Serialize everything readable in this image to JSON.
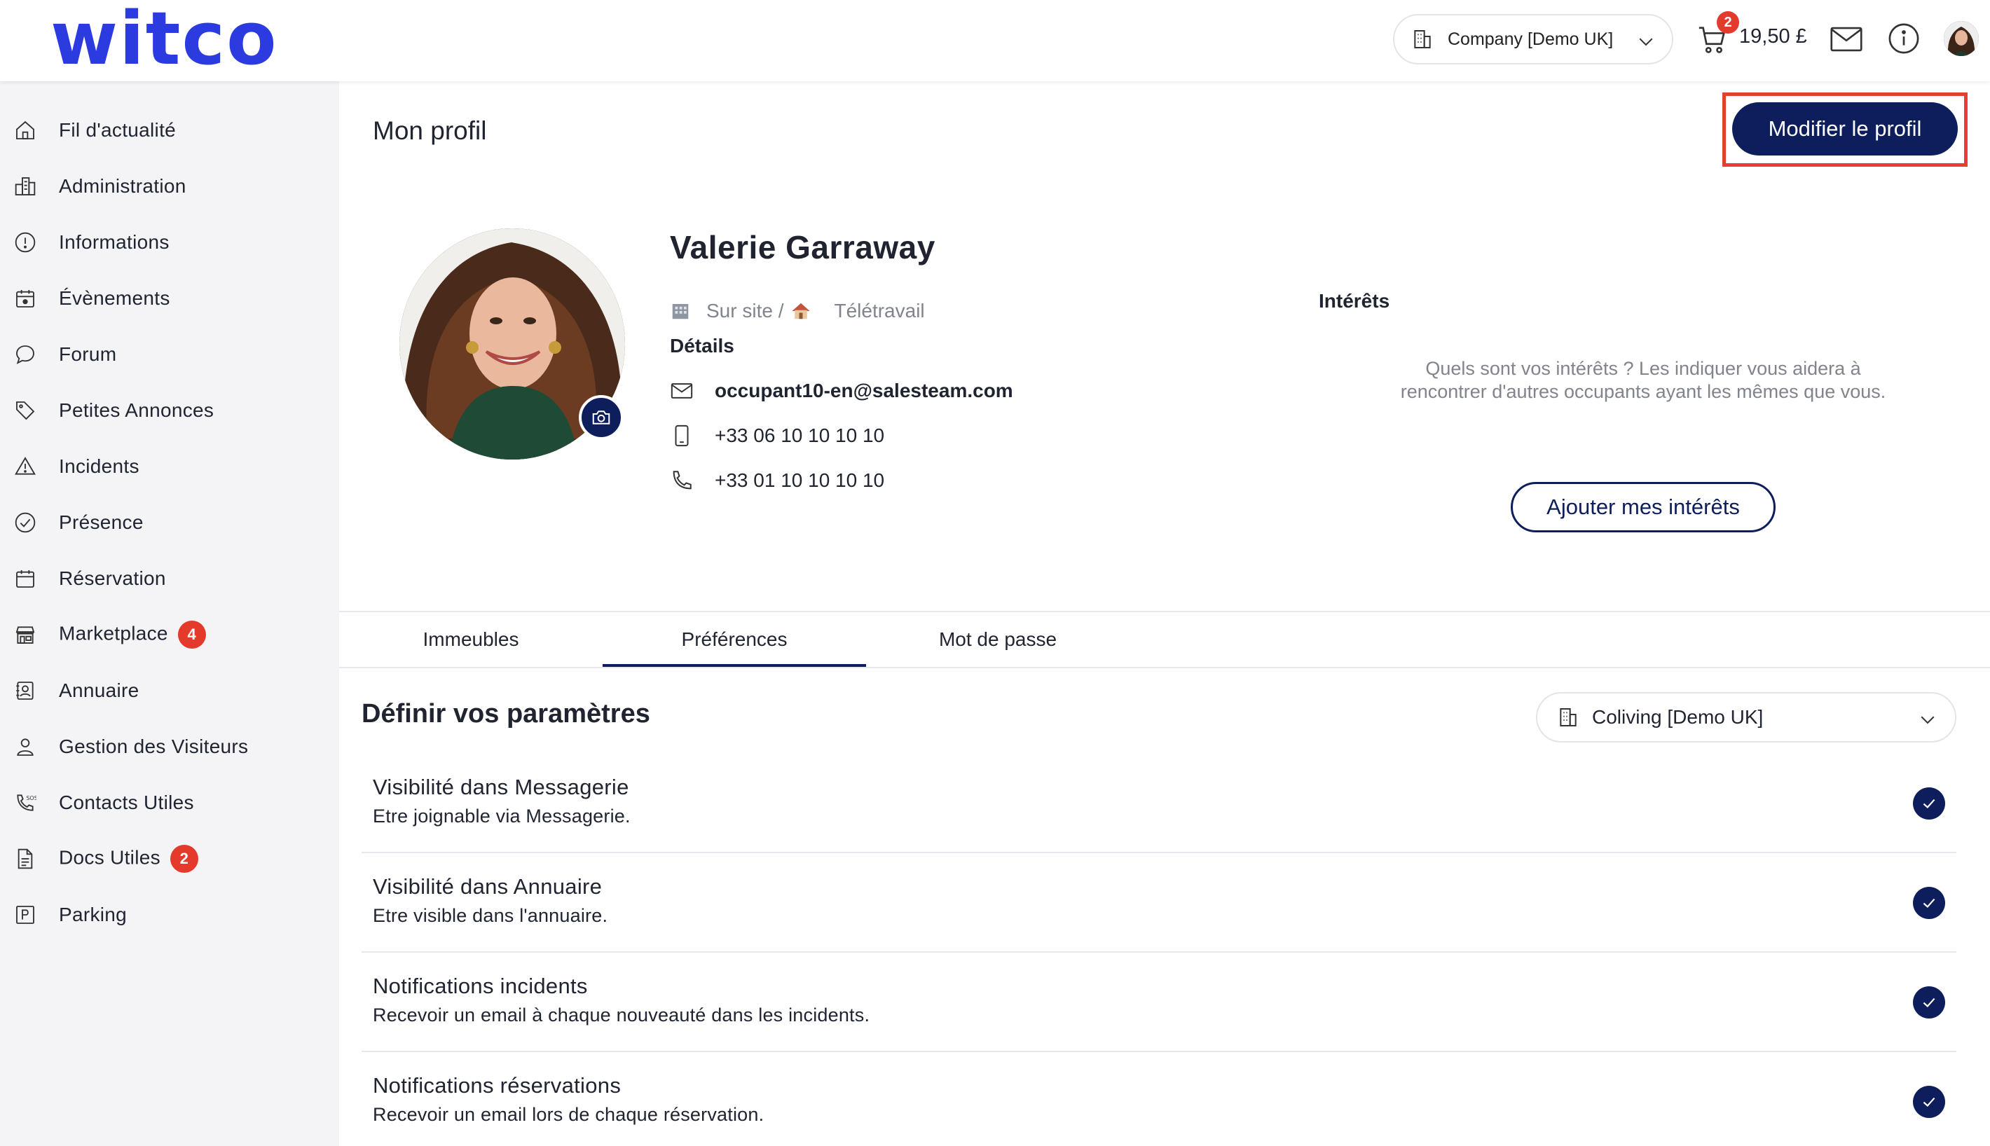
{
  "header": {
    "logo": "witco",
    "company_select": "Company [Demo UK]",
    "cart_count": "2",
    "cart_total": "19,50 £",
    "icons": [
      "building-icon",
      "chevron-down-icon",
      "cart-icon",
      "mail-icon",
      "info-icon",
      "avatar"
    ]
  },
  "sidebar": {
    "items": [
      {
        "label": "Fil d'actualité",
        "icon": "home-icon"
      },
      {
        "label": "Administration",
        "icon": "buildings-icon"
      },
      {
        "label": "Informations",
        "icon": "info-icon"
      },
      {
        "label": "Évènements",
        "icon": "calendar-star-icon"
      },
      {
        "label": "Forum",
        "icon": "chat-bubble-icon"
      },
      {
        "label": "Petites Annonces",
        "icon": "tag-icon"
      },
      {
        "label": "Incidents",
        "icon": "warning-icon"
      },
      {
        "label": "Présence",
        "icon": "check-circle-icon"
      },
      {
        "label": "Réservation",
        "icon": "calendar-icon"
      },
      {
        "label": "Marketplace",
        "icon": "store-icon",
        "badge": "4"
      },
      {
        "label": "Annuaire",
        "icon": "contact-book-icon"
      },
      {
        "label": "Gestion des Visiteurs",
        "icon": "visitor-icon"
      },
      {
        "label": "Contacts Utiles",
        "icon": "sos-phone-icon"
      },
      {
        "label": "Docs Utiles",
        "icon": "document-icon",
        "badge": "2"
      },
      {
        "label": "Parking",
        "icon": "parking-icon"
      }
    ]
  },
  "profile": {
    "page_title": "Mon profil",
    "edit_button": "Modifier le profil",
    "name": "Valerie Garraway",
    "work_on_site": "Sur site /",
    "work_remote": "Télétravail",
    "details_title": "Détails",
    "email": "occupant10-en@salesteam.com",
    "mobile": "+33 06 10 10 10 10",
    "phone": "+33 01 10 10 10 10",
    "interests_title": "Intérêts",
    "interests_text": "Quels sont vos intérêts ? Les indiquer vous aidera à rencontrer d'autres occupants ayant les mêmes que vous.",
    "interests_button": "Ajouter mes intérêts"
  },
  "tabs": [
    {
      "label": "Immeubles",
      "active": false
    },
    {
      "label": "Préférences",
      "active": true
    },
    {
      "label": "Mot de passe",
      "active": false
    }
  ],
  "settings": {
    "title": "Définir vos paramètres",
    "building_select": "Coliving [Demo UK]",
    "items": [
      {
        "title": "Visibilité dans Messagerie",
        "desc": "Etre joignable via Messagerie.",
        "checked": true
      },
      {
        "title": "Visibilité dans Annuaire",
        "desc": "Etre visible dans l'annuaire.",
        "checked": true
      },
      {
        "title": "Notifications incidents",
        "desc": "Recevoir un email à chaque nouveauté dans les incidents.",
        "checked": true
      },
      {
        "title": "Notifications réservations",
        "desc": "Recevoir un email lors de chaque réservation.",
        "checked": true
      }
    ]
  },
  "colors": {
    "brand": "#2b3be0",
    "primary": "#0e1e5c",
    "badge": "#e33a2c",
    "highlight": "#e5402f",
    "sidebar_bg": "#f4f4f6"
  }
}
